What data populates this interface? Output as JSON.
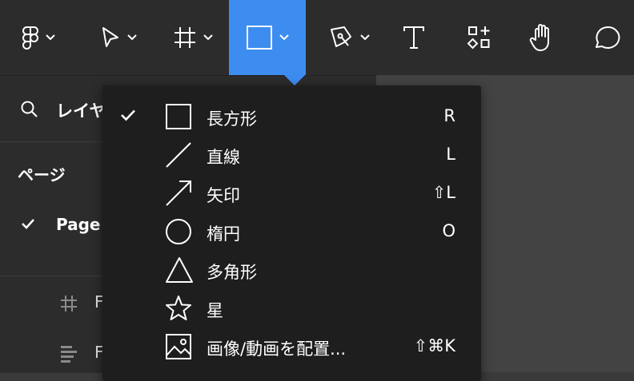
{
  "toolbar": {
    "tools": [
      {
        "name": "figma-menu",
        "icon": "figma-logo-icon",
        "has_dropdown": true
      },
      {
        "name": "move-tool",
        "icon": "cursor-arrow-icon",
        "has_dropdown": true
      },
      {
        "name": "frame-tool",
        "icon": "frame-hash-icon",
        "has_dropdown": true
      },
      {
        "name": "shape-tool",
        "icon": "rectangle-icon",
        "has_dropdown": true,
        "active": true
      },
      {
        "name": "pen-tool",
        "icon": "pen-nib-icon",
        "has_dropdown": true
      },
      {
        "name": "text-tool",
        "icon": "text-t-icon"
      },
      {
        "name": "resources-tool",
        "icon": "components-icon"
      },
      {
        "name": "hand-tool",
        "icon": "hand-icon"
      },
      {
        "name": "comment-tool",
        "icon": "comment-bubble-icon"
      }
    ]
  },
  "left_panel": {
    "layers_label": "レイヤ",
    "pages_heading": "ページ",
    "current_page": "Page",
    "layers": [
      {
        "icon": "frame-hash-icon",
        "label": "F"
      },
      {
        "icon": "align-lines-icon",
        "label": "F"
      }
    ]
  },
  "shape_menu": {
    "items": [
      {
        "label": "長方形",
        "shortcut": "R",
        "icon": "rectangle-icon",
        "checked": true
      },
      {
        "label": "直線",
        "shortcut": "L",
        "icon": "line-icon",
        "checked": false
      },
      {
        "label": "矢印",
        "shortcut": "⇧L",
        "icon": "arrow-icon",
        "checked": false
      },
      {
        "label": "楕円",
        "shortcut": "O",
        "icon": "ellipse-icon",
        "checked": false
      },
      {
        "label": "多角形",
        "shortcut": "",
        "icon": "triangle-icon",
        "checked": false
      },
      {
        "label": "星",
        "shortcut": "",
        "icon": "star-icon",
        "checked": false
      },
      {
        "label": "画像/動画を配置...",
        "shortcut": "⇧⌘K",
        "icon": "image-icon",
        "checked": false
      }
    ]
  },
  "colors": {
    "toolbar_bg": "#2c2c2c",
    "active_tool": "#3d8df1",
    "menu_bg": "#1e1e1e",
    "canvas_bg": "#434343"
  }
}
